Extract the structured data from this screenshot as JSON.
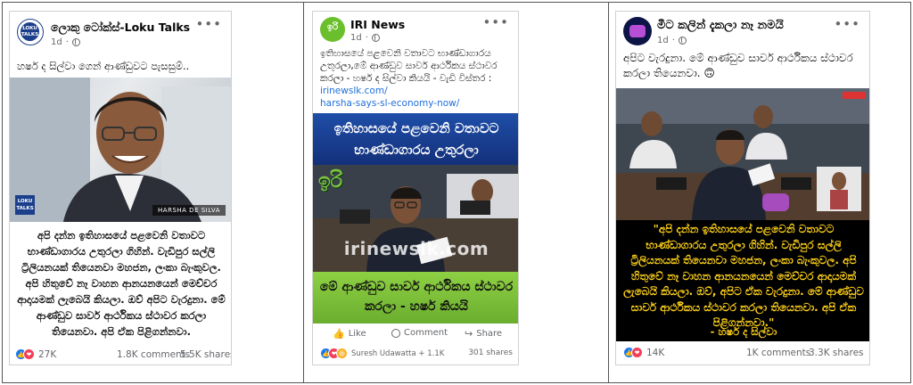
{
  "posts": [
    {
      "page_name": "ලොකු ටෝක්ස්-Loku Talks",
      "time": "1d",
      "text": "හර්ෂ ද සිල්වා ගෙන් ආණ්ඩුවට පැසසුම්..",
      "avatar_text": "LOKU TALKS",
      "image_logo": "LOKU TALKS",
      "image_caption": "HARSHA DE SILVA",
      "quote": "අපි දන්න ඉතිහාසයේ පළවෙනි වතාවට භාණ්ඩාගාරය උතුරලා ගිහින්. වැඩිපුර සල්ලි ට්‍රිලියනයක් තියෙනවා මහජන, ලංකා බැංකුවල. අපි හිතුවේ නෑ වාහන ආනයනයෙන් මෙච්චර ආදායමක් ලැබෙයි කියලා. ඔව් අපිට වැරදුනා. මේ ආණ්ඩුව සාර්ව ආර්ථිකය ස්ථාවර කරලා තියෙනවා. අපි ඒක පිළිගන්නවා.",
      "reactions_count": "27K",
      "comments": "1.8K comments",
      "shares": "5.5K shares"
    },
    {
      "page_name": "IRI News",
      "time": "1d",
      "avatar_text": "ඉරි",
      "text": "ඉතිහාසයේ පළවෙනි වතාවට භාණ්ඩාගාරය උතුරලා,මේ ආණ්ඩුව සාර්ව ආර්ථිකය ස්ථාවර කරලා - හර්ෂ ද සිල්වා කියයි - වැඩි විස්තර :",
      "link_1": "irinewslk.com/",
      "link_2": "harsha-says-sl-economy-now/",
      "banner_top": "ඉතිහාසයේ පළවෙනි වතාවට භාණ්ඩාගාරය උතුරලා",
      "logo": "ඉරි",
      "watermark": "irinewslk.com",
      "banner_bottom": "මේ ආණ්ඩුව සාර්ව ආර්ථිකය ස්ථාවර කරලා - හර්ෂ කියයි",
      "like_label": "Like",
      "comment_label": "Comment",
      "share_label": "Share",
      "reacted_by": "Suresh Udawatta + 1.1K",
      "shares": "301 shares"
    },
    {
      "page_name": "මීට කලින් දැකලා නෑ නමයි",
      "time": "1d",
      "text": "අපිට වැරදුනා. මේ ආණ්ඩුව සාර්ව ආර්ථිකය ස්ථාවර කරලා තියෙනවා. 🙃",
      "quote": "\"අපි දන්න ඉතිහාසයේ පළවෙනි වතාවට භාණ්ඩාගාරය උතුරලා ගිහින්. වැඩිපුර සල්ලි ට්‍රිලියනයක් තියෙනවා මහජන, ලංකා බැංකුවල. අපි හිතුවේ නෑ වාහන ආනයනයෙන් මෙච්චර ආදායමක් ලැබෙයි කියලා. ඔව්, අපිට ඒක වැරදුනා. මේ ආණ්ඩුව සාර්ව ආර්ථිකය ස්ථාවර කරලා තියෙනවා. අපි ඒක පිළිගන්නවා.\"",
      "attribution": "- හර්ෂ ද සිල්වා",
      "reactions_count": "14K",
      "comments": "1K comments",
      "shares": "3.3K shares"
    }
  ],
  "colors": {
    "facebook_blue": "#1877f2",
    "link_blue": "#216fdb",
    "iri_green": "#6bbf2c",
    "iri_banner_blue": "#1a3a8c",
    "iri_banner_green": "#7cc242",
    "quote_yellow": "#ffd21a",
    "quote_bg": "#000000"
  },
  "icons": [
    "more-icon",
    "globe-icon",
    "like-icon",
    "love-icon",
    "haha-icon",
    "comment-icon",
    "share-icon"
  ]
}
